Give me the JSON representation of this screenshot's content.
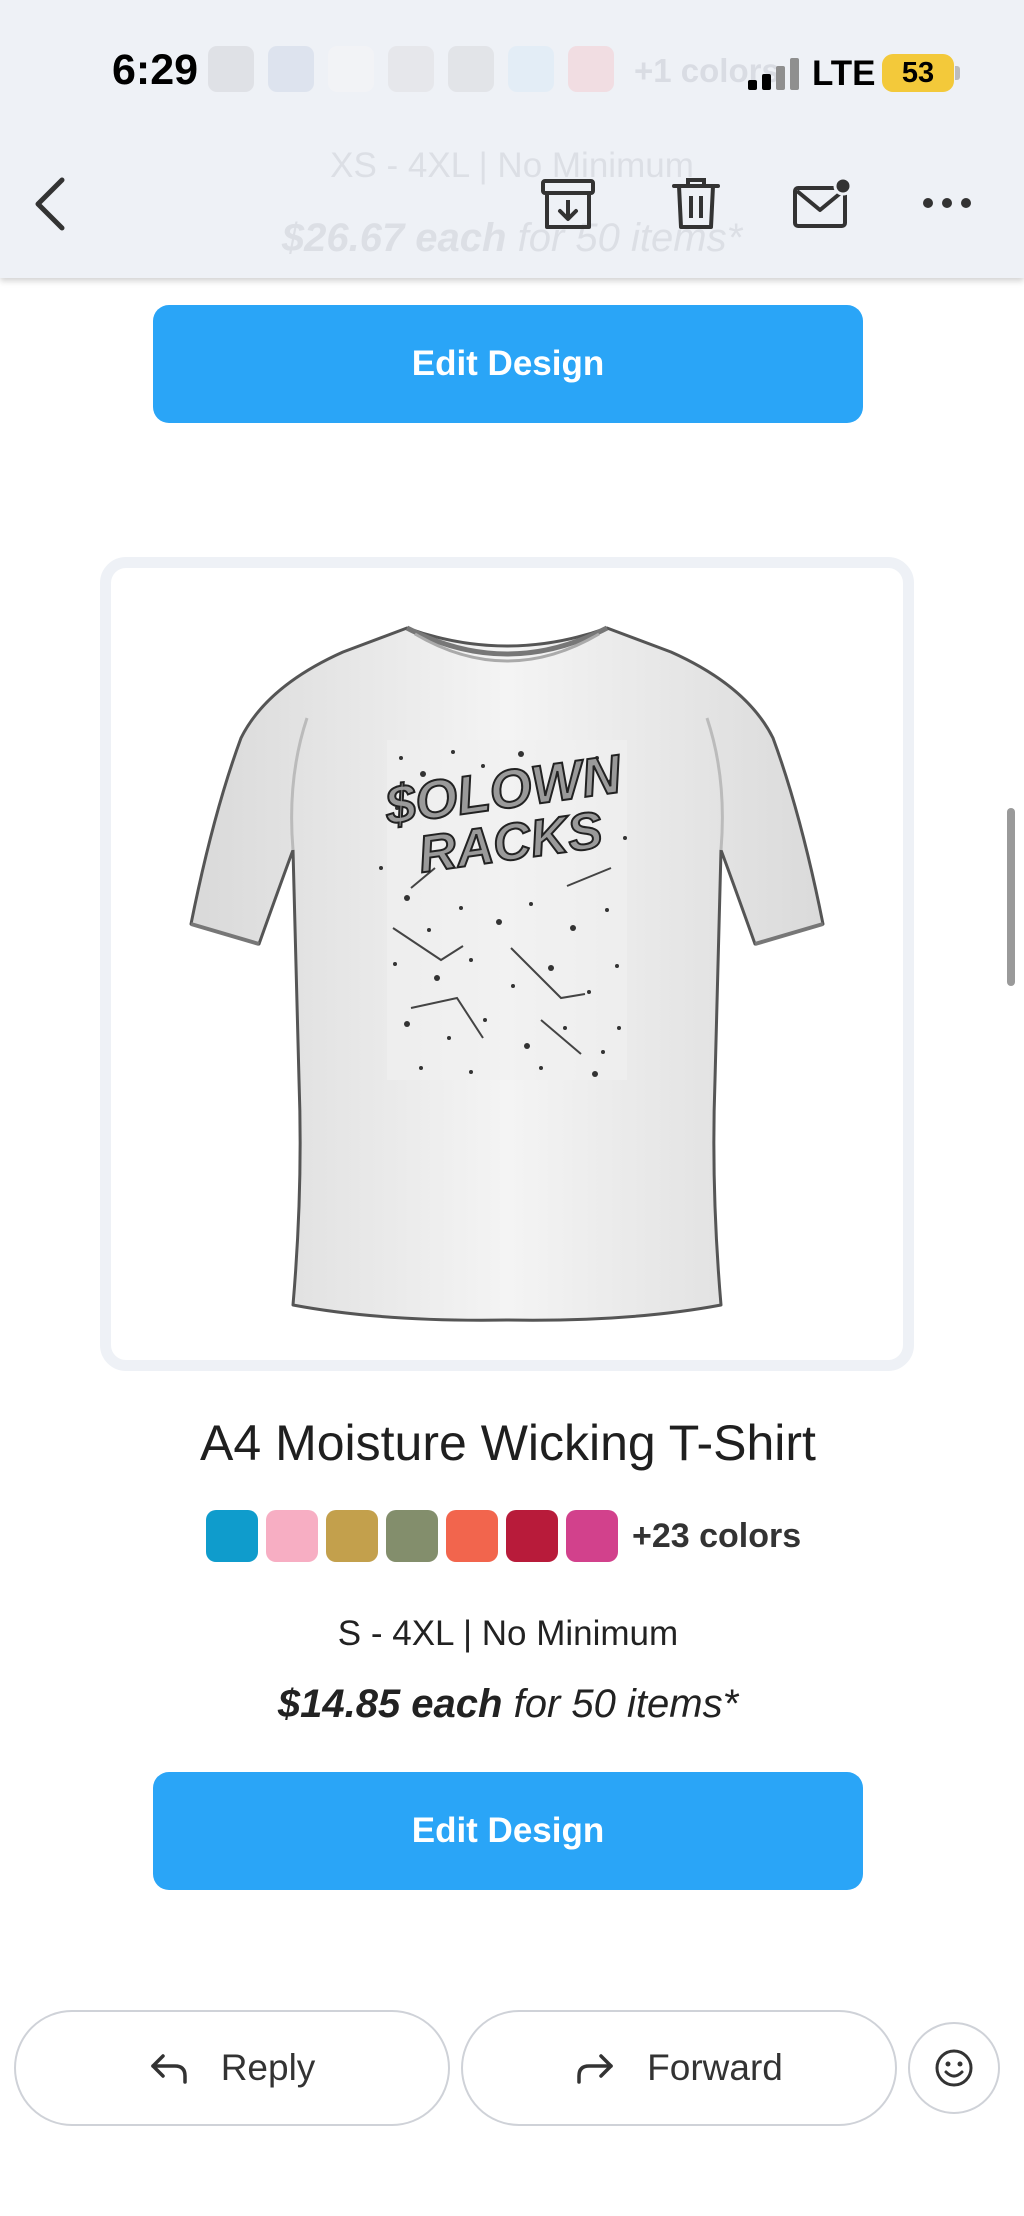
{
  "status_bar": {
    "time": "6:29",
    "network": "LTE",
    "battery": "53",
    "battery_color": "#f3c93a"
  },
  "background_card": {
    "swatch_colors": [
      "#dfe1e6",
      "#dde3ee",
      "#f2f3f6",
      "#e6e7eb",
      "#e2e4e8",
      "#e3edf6",
      "#f1dde2"
    ],
    "more_colors": "+1 colors",
    "sizes": "XS - 4XL | No Minimum",
    "price": "$26.67 each",
    "price_suffix": "for 50 items*"
  },
  "toolbar": {
    "back_icon": "chevron-left-icon",
    "archive_icon": "archive-icon",
    "trash_icon": "trash-icon",
    "mail_icon": "mail-unread-icon",
    "more_icon": "more-horizontal-icon"
  },
  "edit_button_top": {
    "label": "Edit Design"
  },
  "product": {
    "design_text_line1": "$OLOWN",
    "design_text_line2": "RACKS",
    "name": "A4 Moisture Wicking T-Shirt",
    "swatch_colors": [
      "#0f9ccc",
      "#f7aec3",
      "#c3a04c",
      "#838e6c",
      "#f2654d",
      "#b81b3a",
      "#d2418c"
    ],
    "more_colors": "+23 colors",
    "sizes": "S - 4XL | No Minimum",
    "price": "$14.85 each",
    "price_suffix": "for 50 items*"
  },
  "edit_button_bottom": {
    "label": "Edit Design"
  },
  "actions": {
    "reply_label": "Reply",
    "reply_icon": "reply-arrow-icon",
    "forward_label": "Forward",
    "forward_icon": "forward-arrow-icon",
    "emoji_icon": "smiley-icon"
  },
  "accent_color": "#2aa5f7"
}
